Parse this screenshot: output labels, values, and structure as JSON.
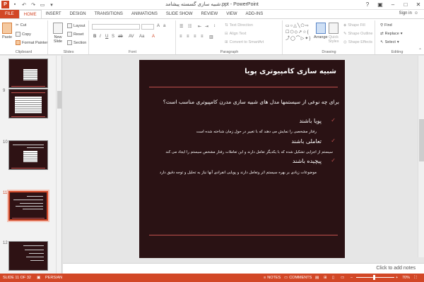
{
  "titlebar": {
    "app_letter": "P",
    "title": "شبیه سازی گسسته پیشامد.ppt - PowerPoint",
    "help": "?"
  },
  "tabs": [
    {
      "label": "FILE",
      "key": "file"
    },
    {
      "label": "HOME",
      "key": "home"
    },
    {
      "label": "INSERT",
      "key": "insert"
    },
    {
      "label": "DESIGN",
      "key": "design"
    },
    {
      "label": "TRANSITIONS",
      "key": "transitions"
    },
    {
      "label": "ANIMATIONS",
      "key": "animations"
    },
    {
      "label": "SLIDE SHOW",
      "key": "slideshow"
    },
    {
      "label": "REVIEW",
      "key": "review"
    },
    {
      "label": "VIEW",
      "key": "view"
    },
    {
      "label": "ADD-INS",
      "key": "addins"
    }
  ],
  "signin": "Sign in",
  "ribbon": {
    "clipboard": {
      "paste": "Paste",
      "cut": "Cut",
      "copy": "Copy",
      "format_painter": "Format Painter",
      "label": "Clipboard"
    },
    "slides": {
      "new_slide": "New Slide",
      "layout": "Layout",
      "reset": "Reset",
      "section": "Section",
      "label": "Slides"
    },
    "font": {
      "label": "Font"
    },
    "paragraph": {
      "text_direction": "Text Direction",
      "align_text": "Align Text",
      "convert_smartart": "Convert to SmartArt",
      "label": "Paragraph"
    },
    "drawing": {
      "arrange": "Arrange",
      "quick_styles": "Quick Styles",
      "shape_fill": "Shape Fill",
      "shape_outline": "Shape Outline",
      "shape_effects": "Shape Effects",
      "label": "Drawing"
    },
    "editing": {
      "find": "Find",
      "replace": "Replace",
      "select": "Select",
      "label": "Editing"
    }
  },
  "thumbnails": [
    {
      "num": "9"
    },
    {
      "num": "10"
    },
    {
      "num": "11"
    },
    {
      "num": "12"
    }
  ],
  "slide": {
    "title": "شبیه سازی کامپیوتری پویا",
    "question": "برای چه نوعی از سیستمها مدل های شبیه سازی مدرن کامپیوتری مناسب است؟",
    "h1": "پویا باشند",
    "b1": "رفتار مشخصی را نمایش می دهند که با تغییر در حول زمان شناخته شده است",
    "h2": "تعاملی باشند",
    "b2": "سیستم از اجزایی تشکیل شده که با یکدیگر تعامل دارند و این تعاملات رفتار مشخص سیستم را ایجاد می کند",
    "h3": "پیچیده باشند",
    "b3": "موضوعات زیادی بر بهره سیستم اثر وتعامل دارند و پویایی انفرادی آنها نیاز به تحلیل و توجه دقیق دارد"
  },
  "notes_placeholder": "Click to add notes",
  "status": {
    "slide_info": "SLIDE 11 OF 32",
    "language": "PERSIAN",
    "notes": "NOTES",
    "comments": "COMMENTS",
    "zoom": "70%"
  }
}
